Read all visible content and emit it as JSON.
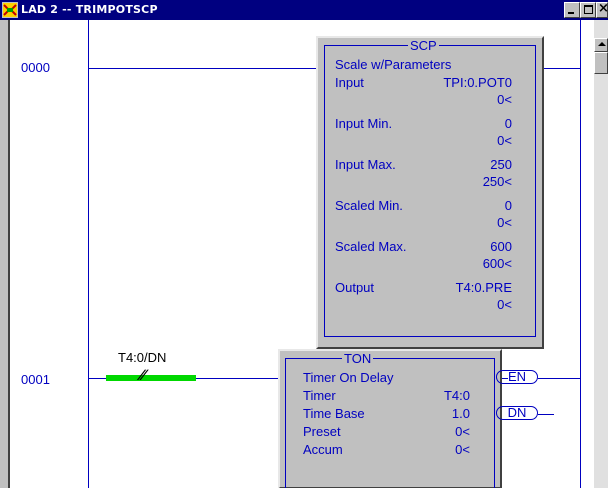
{
  "window": {
    "title": "LAD 2 -- TRIMPOTSCP",
    "close_glyph": "×"
  },
  "rungs": [
    {
      "number": "0000"
    },
    {
      "number": "0001"
    }
  ],
  "scp": {
    "title": "SCP",
    "subtitle": "Scale w/Parameters",
    "input_label": "Input",
    "input_addr": "TPI:0.POT0",
    "input_val": "0<",
    "input_min_label": "Input Min.",
    "input_min": "0",
    "input_min_val": "0<",
    "input_max_label": "Input Max.",
    "input_max": "250",
    "input_max_val": "250<",
    "scaled_min_label": "Scaled Min.",
    "scaled_min": "0",
    "scaled_min_val": "0<",
    "scaled_max_label": "Scaled Max.",
    "scaled_max": "600",
    "scaled_max_val": "600<",
    "output_label": "Output",
    "output_addr": "T4:0.PRE",
    "output_val": "0<"
  },
  "contact": {
    "tag": "T4:0/DN",
    "symbol": "∕∕",
    "highlight_color": "#00d800"
  },
  "ton": {
    "title": "TON",
    "subtitle": "Timer On Delay",
    "timer_label": "Timer",
    "timer_val": "T4:0",
    "timebase_label": "Time Base",
    "timebase_val": "1.0",
    "preset_label": "Preset",
    "preset_val": "0<",
    "accum_label": "Accum",
    "accum_val": "0<"
  },
  "coils": {
    "en": "EN",
    "dn": "DN"
  },
  "colors": {
    "wire": "#0000c0",
    "titlebar": "#000080",
    "panel": "#c0c0c0"
  }
}
